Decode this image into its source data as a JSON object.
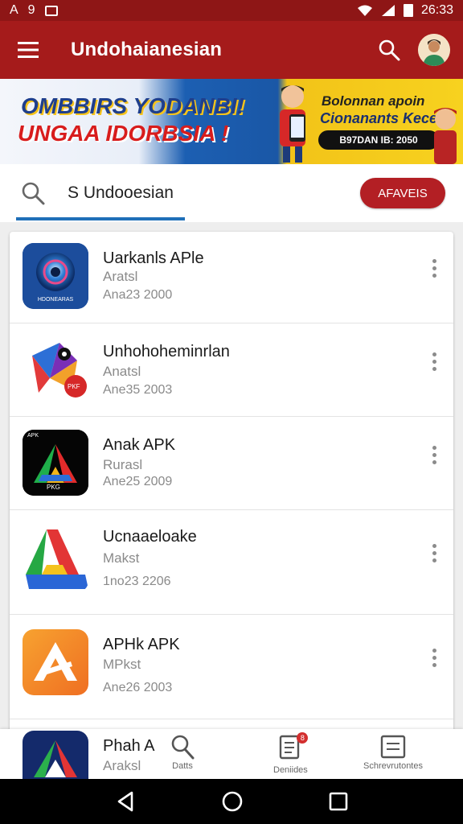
{
  "status_bar": {
    "left_letter": "A",
    "left_digit": "9",
    "time": "26:33"
  },
  "app_bar": {
    "title": "Undohaianesian",
    "menu_icon": "menu-icon",
    "search_icon": "search-icon",
    "avatar_icon": "avatar"
  },
  "banner": {
    "line1": "OMBBIRS YODANBI!",
    "line2": "UNGAA IDORBSIA !",
    "line3": "Bolonnan apoin",
    "line4": "Cionanants Kecela",
    "pill": "B97DAN IB: 2050"
  },
  "search": {
    "query": "S Undooesian",
    "action_label": "AFAVEIS"
  },
  "apps": [
    {
      "name": "Uarkanls APle",
      "sub": "Aratsl",
      "meta": "Ana23 2000",
      "icon": "camera-lens-icon",
      "icon_caption": "HDONEARAS"
    },
    {
      "name": "Unhohoheminrlan",
      "sub": "Anatsl",
      "meta": "Ane35 2003",
      "icon": "colorful-fold-icon",
      "icon_caption": "PKF"
    },
    {
      "name": "Anak APK",
      "sub": "Rurasl",
      "meta": "Ane25 2009",
      "icon": "apk-triangle-icon",
      "icon_caption": "APK",
      "icon_caption2": "PKG"
    },
    {
      "name": "Ucnaaeloake",
      "sub": "Makst",
      "meta": "1no23 2206",
      "icon": "green-triangle-icon"
    },
    {
      "name": "APHk APK",
      "sub": "MPkst",
      "meta": "Ane26 2003",
      "icon": "orange-triangle-icon"
    }
  ],
  "partial_row": {
    "name": "Phah A",
    "sub": "Araksl"
  },
  "bottom_nav": {
    "items": [
      {
        "label": "Datts",
        "icon": "search-person-icon"
      },
      {
        "label": "Deniides",
        "icon": "document-icon",
        "badge": "8"
      },
      {
        "label": "Schrevrutontes",
        "icon": "list-icon"
      }
    ]
  },
  "colors": {
    "primary": "#a51b1b",
    "status_bar": "#8e1616",
    "accent_button": "#b31f24",
    "tab_underline": "#1f6fb8"
  }
}
